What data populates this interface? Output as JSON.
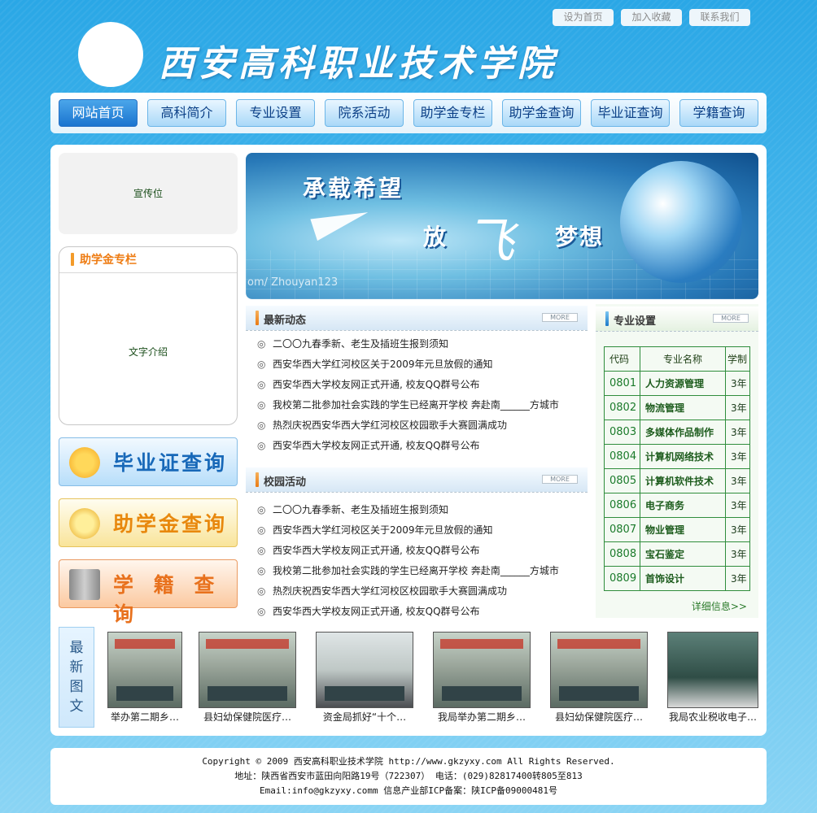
{
  "top_links": [
    "设为首页",
    "加入收藏",
    "联系我们"
  ],
  "school_name": "西安高科职业技术学院",
  "nav": [
    "网站首页",
    "高科简介",
    "专业设置",
    "院系活动",
    "助学金专栏",
    "助学金查询",
    "毕业证查询",
    "学籍查询"
  ],
  "promo_label": "宣传位",
  "aid_column": {
    "title": "助学金专栏",
    "body": "文字介绍"
  },
  "quick_buttons": [
    "毕业证查询",
    "助学金查询",
    "学 籍 查 询"
  ],
  "banner": {
    "slogan_a": "承载希望",
    "slogan_b": "放",
    "fly": "飞",
    "slogan_c": "梦想",
    "watermark": "om/ Zhouyan123"
  },
  "news": {
    "title": "最新动态",
    "more": "MORE",
    "items": [
      "二〇〇九春季新、老生及插班生报到须知",
      "西安华西大学红河校区关于2009年元旦放假的通知",
      "西安华西大学校友网正式开通, 校友QQ群号公布",
      "我校第二批参加社会实践的学生已经离开学校 奔赴南______方城市",
      "热烈庆祝西安华西大学红河校区校园歌手大赛圆满成功",
      "西安华西大学校友网正式开通, 校友QQ群号公布"
    ]
  },
  "campus": {
    "title": "校园活动",
    "more": "MORE",
    "items": [
      "二〇〇九春季新、老生及插班生报到须知",
      "西安华西大学红河校区关于2009年元旦放假的通知",
      "西安华西大学校友网正式开通, 校友QQ群号公布",
      "我校第二批参加社会实践的学生已经离开学校 奔赴南______方城市",
      "热烈庆祝西安华西大学红河校区校园歌手大赛圆满成功",
      "西安华西大学校友网正式开通, 校友QQ群号公布"
    ]
  },
  "majors": {
    "title": "专业设置",
    "more": "MORE",
    "headers": [
      "代码",
      "专业名称",
      "学制"
    ],
    "rows": [
      [
        "0801",
        "人力资源管理",
        "3年"
      ],
      [
        "0802",
        "物流管理",
        "3年"
      ],
      [
        "0803",
        "多媒体作品制作",
        "3年"
      ],
      [
        "0804",
        "计算机网络技术",
        "3年"
      ],
      [
        "0805",
        "计算机软件技术",
        "3年"
      ],
      [
        "0806",
        "电子商务",
        "3年"
      ],
      [
        "0807",
        "物业管理",
        "3年"
      ],
      [
        "0808",
        "宝石鉴定",
        "3年"
      ],
      [
        "0809",
        "首饰设计",
        "3年"
      ]
    ],
    "detail_link": "详细信息>>"
  },
  "latest_pics": {
    "tag": [
      "最",
      "新",
      "图",
      "文"
    ],
    "captions": [
      "举办第二期乡…",
      "县妇幼保健院医疗…",
      "资金局抓好“十个…",
      "我局举办第二期乡…",
      "县妇幼保健院医疗…",
      "我局农业税收电子…"
    ]
  },
  "footer": {
    "line1": "Copyright © 2009  西安高科职业技术学院  http://www.gkzyxy.com All Rights Reserved.",
    "line2": "地址：陕西省西安市蓝田向阳路19号（722307）       电话：(029)82817400转805至813",
    "line3": "Email:info@gkzyxy.comm       信息产业部ICP备案：陕ICP备09000481号"
  },
  "colors": {
    "sky_blue": "#2aa7e6",
    "nav_active": "#1a74cf",
    "major_green": "#2f8d3c",
    "aid_orange": "#ee7c13"
  }
}
